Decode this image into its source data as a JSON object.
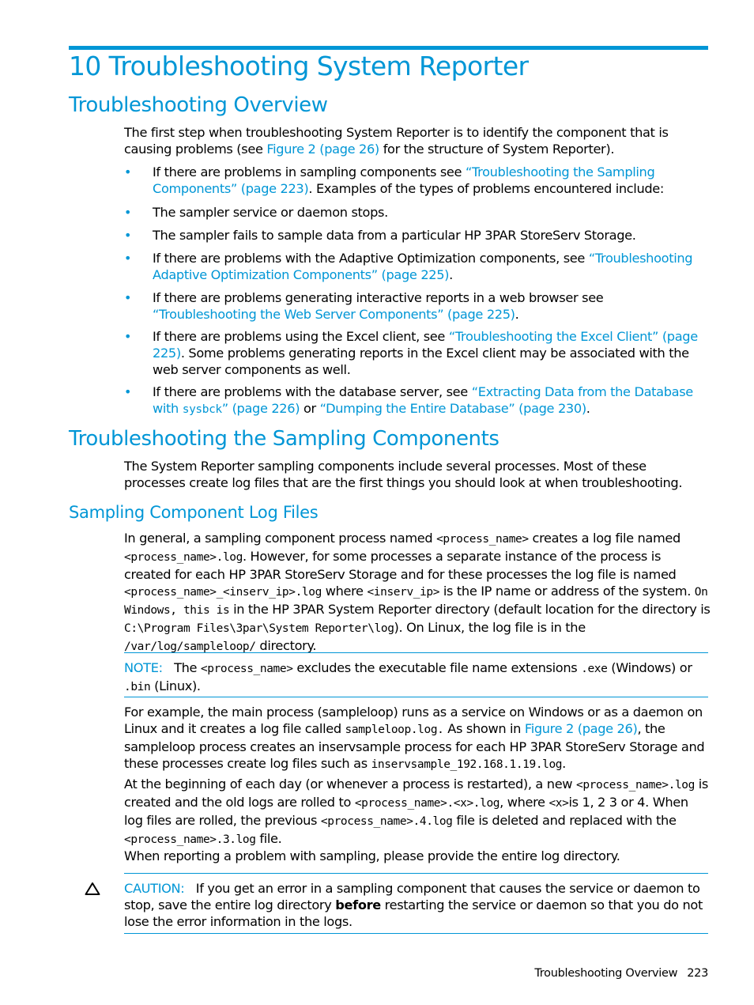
{
  "chapter": {
    "title": "10 Troubleshooting System Reporter"
  },
  "section1": {
    "heading": "Troubleshooting Overview",
    "intro": {
      "t1": "The first step when troubleshooting System Reporter is to identify the component that is causing problems (see ",
      "link": "Figure 2 (page 26)",
      "t2": " for the structure of System Reporter)."
    },
    "bullets": [
      {
        "t1": "If there are problems in sampling components see ",
        "link": "“Troubleshooting the Sampling Components” (page 223)",
        "t2": ". Examples of the types of problems encountered include:"
      },
      {
        "t1": "The sampler service or daemon stops."
      },
      {
        "t1": "The sampler fails to sample data from a particular HP 3PAR StoreServ Storage."
      },
      {
        "t1": "If there are problems with the Adaptive Optimization components, see ",
        "link": "“Troubleshooting Adaptive Optimization Components” (page 225)",
        "t2": "."
      },
      {
        "t1": "If there are problems generating interactive reports in a web browser see ",
        "link": "“Troubleshooting the Web Server Components” (page 225)",
        "t2": "."
      },
      {
        "t1": "If there are problems using the Excel client, see ",
        "link": "“Troubleshooting the Excel Client” (page 225)",
        "t2": ". Some problems generating reports in the Excel client may be associated with the web server components as well."
      },
      {
        "t1": "If there are problems with the database server, see ",
        "link_a": "“Extracting Data from the Database with ",
        "link_code": "sysbck",
        "link_b": "” (page 226)",
        "t2": " or ",
        "link2": "“Dumping the Entire Database” (page 230)",
        "t3": "."
      }
    ]
  },
  "section2": {
    "heading": "Troubleshooting the Sampling Components",
    "intro": "The System Reporter sampling components include several processes. Most of these processes create log files that are the first things you should look at when troubleshooting."
  },
  "section3": {
    "heading": "Sampling Component Log Files",
    "p1": {
      "t1": "In general, a sampling component process named ",
      "c1": "<process_name>",
      "t2": " creates a log file named ",
      "c2": "<process_name>.log",
      "t3": ". However, for some processes a separate instance of the process is created for each HP 3PAR StoreServ Storage and for these processes the log file is named ",
      "c3": "<process_name>_<inserv_ip>.log",
      "t4": " where ",
      "c4": "<inserv_ip>",
      "t5": " is the IP name or address of the system. ",
      "c5": "On Windows, this is",
      "t6": " in the HP 3PAR System Reporter directory (default location for the directory is ",
      "c6": "C:\\Program Files\\3par\\System Reporter\\log",
      "t7": "). On Linux, the log file is in the ",
      "c7": "/var/log/sampleloop/",
      "t8": " directory."
    },
    "note": {
      "label": "NOTE:",
      "t1": "The ",
      "c1": "<process_name>",
      "t2": " excludes the executable file name extensions ",
      "c2": ".exe",
      "t3": " (Windows) or ",
      "c3": ".bin",
      "t4": " (Linux)."
    },
    "p2": {
      "t1": "For example, the main process (sampleloop) runs as a service on Windows or as a daemon on Linux and it creates a log file called ",
      "c1": "sampleloop.log.",
      "t2": " As shown in ",
      "link": "Figure 2 (page 26)",
      "t3": ", the sampleloop process creates an inservsample process for each HP 3PAR StoreServ Storage and these processes create log files such as ",
      "c2": "inservsample_192.168.1.19.log",
      "t4": "."
    },
    "p3": {
      "t1": "At the beginning of each day (or whenever a process is restarted), a new ",
      "c1": "<process_name>.log",
      "t2": " is created and the old logs are rolled to ",
      "c2": "<process_name>.<x>.log",
      "t3": ", where ",
      "c3": "<x>",
      "t4": "is 1, 2 3 or 4. When log files are rolled, the previous ",
      "c4": "<process_name>.4.log",
      "t5": " file is deleted and replaced with the ",
      "c5": "<process_name>.3.log",
      "t6": " file."
    },
    "p4": "When reporting a problem with sampling, please provide the entire log directory.",
    "caution": {
      "icon": "warning-triangle-icon",
      "label": "CAUTION:",
      "t1": "If you get an error in a sampling component that causes the service or daemon to stop, save the entire log directory ",
      "bold": "before",
      "t2": " restarting the service or daemon so that you do not lose the error information in the logs."
    }
  },
  "footer": {
    "section": "Troubleshooting Overview",
    "page": "223"
  }
}
